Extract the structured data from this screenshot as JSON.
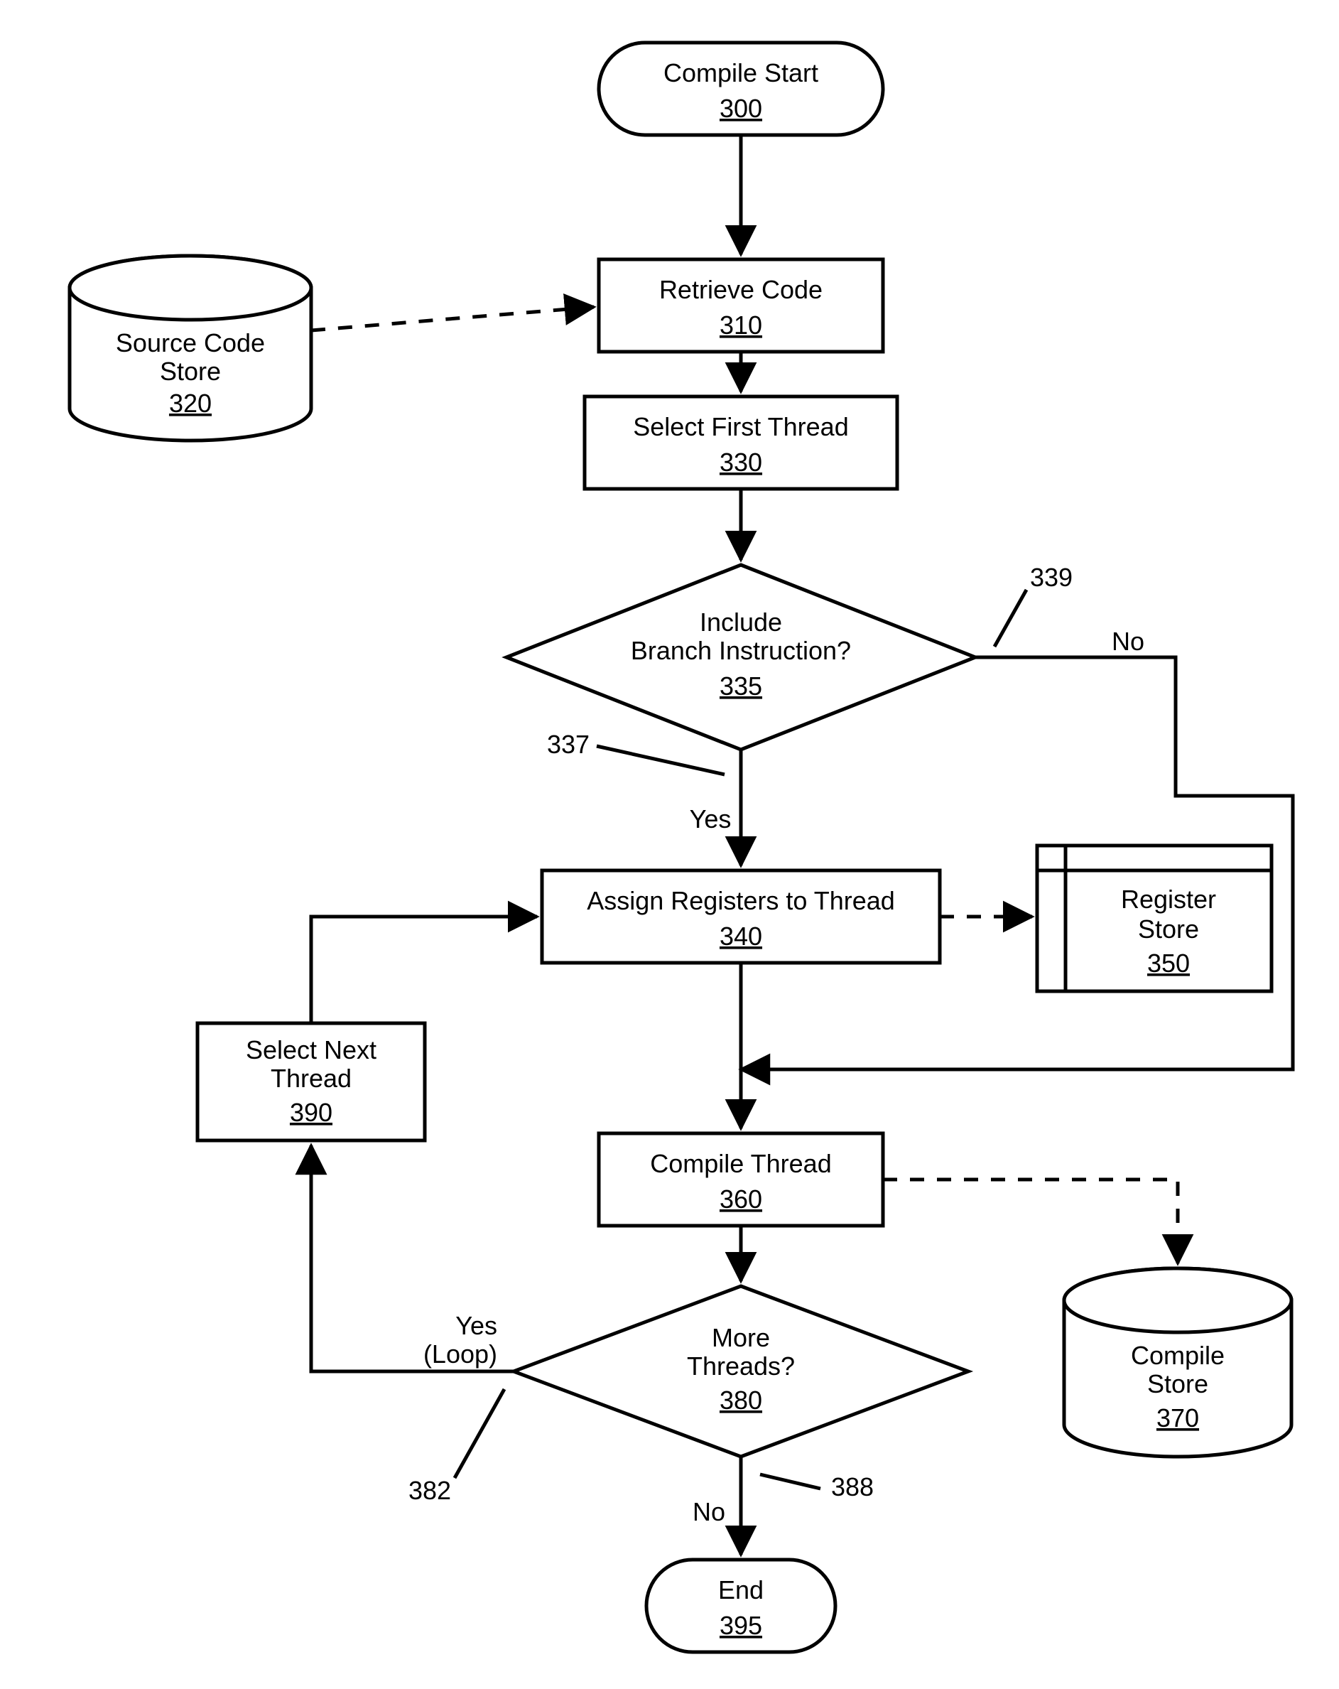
{
  "nodes": {
    "start": {
      "label": "Compile Start",
      "ref": "300"
    },
    "retrieve": {
      "label": "Retrieve Code",
      "ref": "310"
    },
    "srcstore": {
      "label1": "Source Code",
      "label2": "Store",
      "ref": "320"
    },
    "selfirst": {
      "label": "Select First Thread",
      "ref": "330"
    },
    "branchQ": {
      "label1": "Include",
      "label2": "Branch Instruction?",
      "ref": "335"
    },
    "assign": {
      "label": "Assign Registers to Thread",
      "ref": "340"
    },
    "regstore": {
      "label1": "Register",
      "label2": "Store",
      "ref": "350"
    },
    "compile": {
      "label": "Compile Thread",
      "ref": "360"
    },
    "cmpstore": {
      "label1": "Compile",
      "label2": "Store",
      "ref": "370"
    },
    "moreQ": {
      "label1": "More",
      "label2": "Threads?",
      "ref": "380"
    },
    "selnext": {
      "label1": "Select Next",
      "label2": "Thread",
      "ref": "390"
    },
    "end": {
      "label": "End",
      "ref": "395"
    }
  },
  "edges": {
    "branchYes": {
      "label": "Yes",
      "ref": "337"
    },
    "branchNo": {
      "label": "No",
      "ref": "339"
    },
    "moreYes": {
      "label1": "Yes",
      "label2": "(Loop)",
      "ref": "382"
    },
    "moreNo": {
      "label": "No",
      "ref": "388"
    }
  }
}
